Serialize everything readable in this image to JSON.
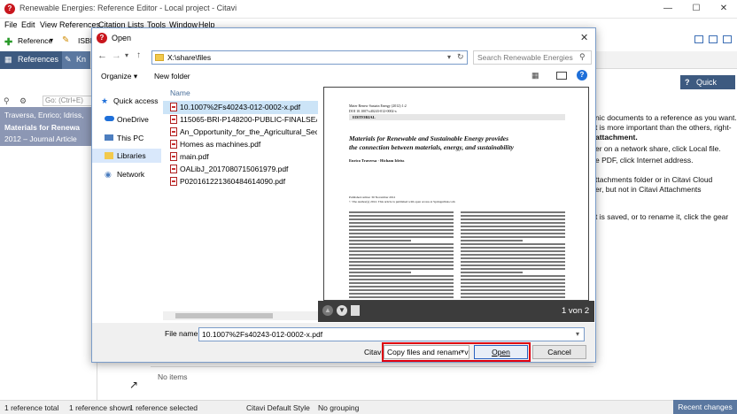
{
  "app": {
    "logo_letter": "?",
    "title": "Renewable Energies: Reference Editor - Local project - Citavi",
    "menu": [
      "File",
      "Edit",
      "View",
      "References",
      "Citation",
      "Lists",
      "Tools",
      "Window",
      "Help"
    ],
    "toolbar_reference": "Reference",
    "toolbar_isbn": "ISBN",
    "tabs": [
      "References",
      "Kn"
    ],
    "search_placeholder": "Go: (Ctrl+E)",
    "selected_reference": {
      "authors": "Traversa, Enrico; Idriss,",
      "title": "Materials for Renewa",
      "meta": "2012 – Journal Article"
    },
    "quick_help": "Quick Help",
    "help_lines": [
      "nic documents to a reference as you want.",
      "t is more important than the others, right-",
      "attachment.",
      "er on a network share, click Local file.",
      "e PDF, click Internet address.",
      "ttachments folder or in Citavi Cloud",
      "er, but not in Citavi Attachments",
      "t is saved, or to rename it, click the gear"
    ],
    "no_items": "No items",
    "status": {
      "total": "1 reference total",
      "shown": "1 reference shown",
      "selected": "1 reference selected",
      "style": "Citavi Default Style",
      "grouping": "No grouping",
      "recent": "Recent changes"
    }
  },
  "dialog": {
    "title": "Open",
    "path": "X:\\share\\files",
    "search_placeholder": "Search Renewable Energies",
    "organize": "Organize",
    "new_folder": "New folder",
    "nav_items": [
      "Quick access",
      "OneDrive",
      "This PC",
      "Libraries",
      "Network"
    ],
    "column_name": "Name",
    "files": [
      "10.1007%2Fs40243-012-0002-x.pdf",
      "115065-BRI-P148200-PUBLIC-FINALSEAR...",
      "An_Opportunity_for_the_Agricultural_Sec...",
      "Homes as machines.pdf",
      "main.pdf",
      "OALibJ_2017080715061979.pdf",
      "P020161221360484614090.pdf"
    ],
    "preview": {
      "journal": "Mater Renew Sustain Energy (2012) 1:2",
      "doi": "DOI 10.1007/s40243-012-0002-x",
      "section": "EDITORIAL",
      "title_line1": "Materials for Renewable and Sustainable Energy provides",
      "title_line2": "the connection between materials, energy, and sustainability",
      "authors": "Enrico Traversa · Hicham Idriss",
      "published": "Published online: 30 November 2012",
      "copyright": "© The Author(s) 2012. This article is published with open access at Springerlink.com",
      "page_counter": "1 von 2"
    },
    "filename_label": "File name:",
    "filename_value": "10.1007%2Fs40243-012-0002-x.pdf",
    "citavi_label": "Citavi",
    "action_option": "Copy files and rename v",
    "open_label": "Open",
    "cancel_label": "Cancel"
  },
  "colors": {
    "citavi_blue": "#3d5a80",
    "highlight_red": "#e00010"
  }
}
